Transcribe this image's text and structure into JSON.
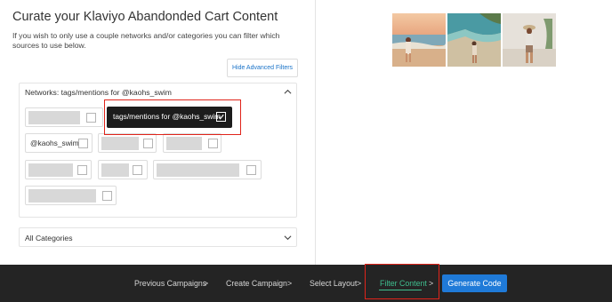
{
  "header": {
    "title": "Curate your Klaviyo Abandonded Cart Content",
    "description": "If you wish to only use a couple networks and/or categories you can filter which sources to use below."
  },
  "filters": {
    "hide_button": "Hide Advanced Filters",
    "networks_header": "Networks: tags/mentions for @kaohs_swim",
    "chip_handle": "@kaohs_swim",
    "tooltip_text": "tags/mentions for @kaohs_swim",
    "categories_label": "All Categories"
  },
  "footer": {
    "steps": [
      "Previous Campaigns",
      "Create Campaign",
      "Select Layout",
      "Filter Content"
    ],
    "separator": ">",
    "active_step": "Filter Content",
    "generate_button": "Generate Code",
    "colors": {
      "active": "#3fbf8f",
      "button": "#1f7ad8",
      "bar": "#242424"
    }
  },
  "preview": {
    "photos": [
      "beach-photo-sunset",
      "beach-photo-cove",
      "beach-photo-portrait"
    ]
  },
  "icons": [
    "chevron-up-icon",
    "chevron-down-icon",
    "checkbox-icon",
    "checkmark-icon"
  ]
}
